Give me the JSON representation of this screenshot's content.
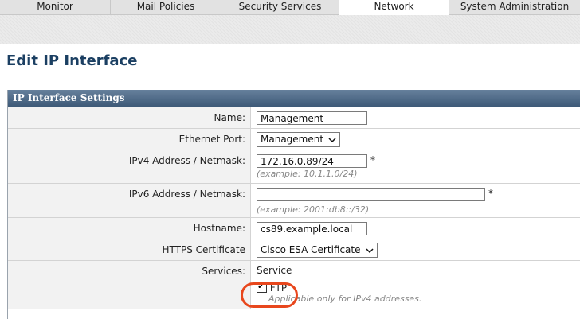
{
  "nav": {
    "tabs": [
      {
        "label": "Monitor"
      },
      {
        "label": "Mail Policies"
      },
      {
        "label": "Security Services"
      },
      {
        "label": "Network",
        "active": true
      },
      {
        "label": "System Administration"
      }
    ]
  },
  "page": {
    "title": "Edit IP Interface"
  },
  "panel": {
    "header": "IP Interface Settings",
    "name": {
      "label": "Name:",
      "value": "Management"
    },
    "ethernet_port": {
      "label": "Ethernet Port:",
      "value": "Management"
    },
    "ipv4": {
      "label": "IPv4 Address / Netmask:",
      "value": "172.16.0.89/24",
      "required_mark": "*",
      "hint": "(example: 10.1.1.0/24)"
    },
    "ipv6": {
      "label": "IPv6 Address / Netmask:",
      "value": "",
      "required_mark": "*",
      "hint": "(example: 2001:db8::/32)"
    },
    "hostname": {
      "label": "Hostname:",
      "value": "cs89.example.local"
    },
    "https_cert": {
      "label": "HTTPS Certificate",
      "value": "Cisco ESA Certificate"
    },
    "services": {
      "label": "Services:",
      "column_header": "Service",
      "ftp": {
        "label": "FTP",
        "checked": true,
        "note": "Applicable only for IPv4 addresses."
      }
    }
  },
  "colors": {
    "highlight_circle": "#e8471d",
    "header_blue": "#3e5a78",
    "title_blue": "#1b3f62"
  }
}
